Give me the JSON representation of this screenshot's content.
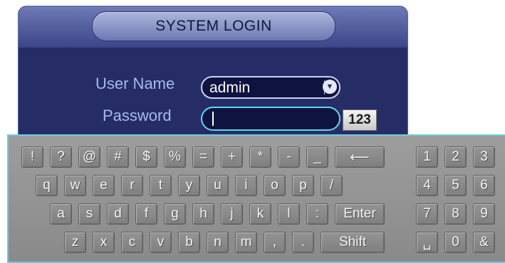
{
  "dialog": {
    "title": "SYSTEM LOGIN",
    "user_name_label": "User Name",
    "user_name_value": "admin",
    "password_label": "Password",
    "password_value": "",
    "input_mode_label": "123"
  },
  "keyboard": {
    "row1": [
      "!",
      "?",
      "@",
      "#",
      "$",
      "%",
      "=",
      "+",
      "*",
      "-",
      "_"
    ],
    "backspace": "⟵",
    "row2": [
      "q",
      "w",
      "e",
      "r",
      "t",
      "y",
      "u",
      "i",
      "o",
      "p",
      "/"
    ],
    "row3": [
      "a",
      "s",
      "d",
      "f",
      "g",
      "h",
      "j",
      "k",
      "l",
      ":"
    ],
    "enter": "Enter",
    "row4": [
      "z",
      "x",
      "c",
      "v",
      "b",
      "n",
      "m",
      ",",
      "."
    ],
    "shift": "Shift",
    "numpad": [
      "1",
      "2",
      "3",
      "4",
      "5",
      "6",
      "7",
      "8",
      "9",
      "␣",
      "0",
      "&"
    ]
  },
  "colors": {
    "panel_bg": "#262d66",
    "label_text": "#a7b9ec",
    "focus_border": "#62d6ec",
    "keyboard_bg": "#8e8e8e"
  }
}
